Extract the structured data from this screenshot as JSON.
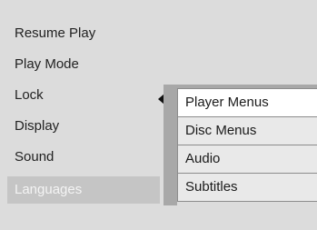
{
  "main_menu": {
    "items": [
      {
        "label": "Resume Play"
      },
      {
        "label": "Play Mode"
      },
      {
        "label": "Lock"
      },
      {
        "label": "Display"
      },
      {
        "label": "Sound"
      },
      {
        "label": "Languages"
      }
    ],
    "selected_label": "Languages"
  },
  "submenu": {
    "items": [
      {
        "label": "Player Menus"
      },
      {
        "label": "Disc Menus"
      },
      {
        "label": "Audio"
      },
      {
        "label": "Subtitles"
      }
    ],
    "active_label": "Player Menus"
  },
  "icons": {
    "pointer": "left-pointer-icon"
  },
  "colors": {
    "background": "#dcdcdc",
    "selected_item_bg": "#c5c5c5",
    "selected_item_text": "#f4f4f4",
    "submenu_item_bg": "#e9e9e9",
    "submenu_active_bg": "#ffffff",
    "submenu_border": "#8c8c8c"
  }
}
